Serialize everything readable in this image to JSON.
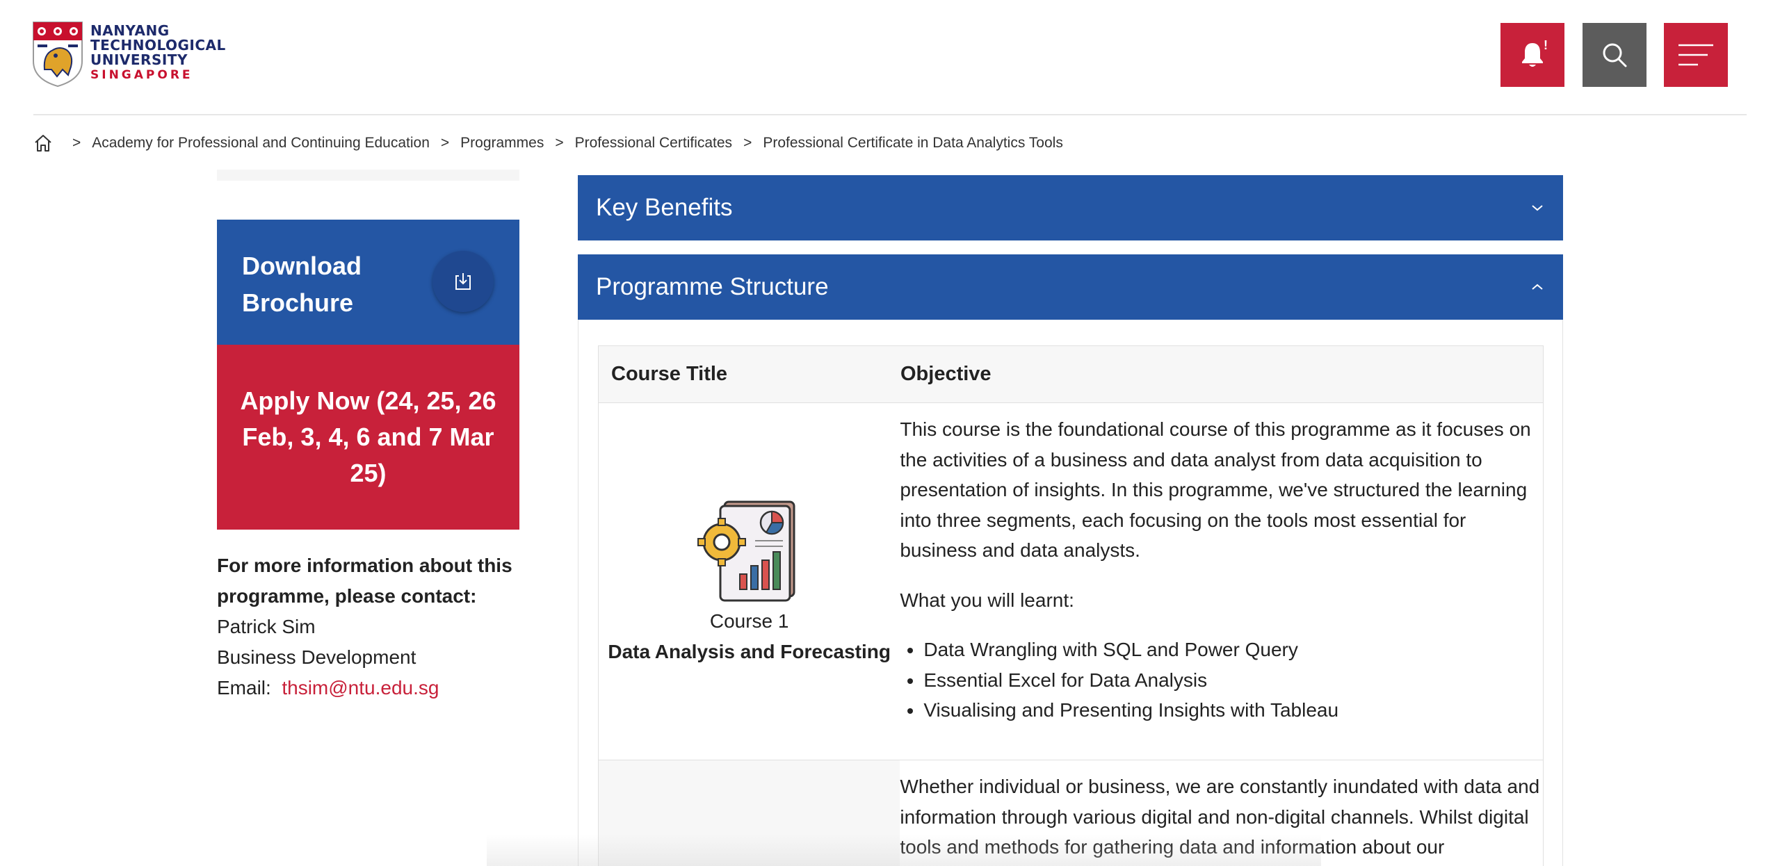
{
  "logo": {
    "line1": "NANYANG",
    "line2": "TECHNOLOGICAL",
    "line3": "UNIVERSITY",
    "line4": "SINGAPORE"
  },
  "header": {
    "notification_badge": "!",
    "icons": [
      "bell-icon",
      "search-icon",
      "menu-icon"
    ]
  },
  "breadcrumb": {
    "separator": ">",
    "items": [
      "Academy for Professional and Continuing Education",
      "Programmes",
      "Professional Certificates",
      "Professional Certificate in Data Analytics Tools"
    ]
  },
  "sidebar": {
    "download_label": "Download Brochure",
    "apply_label": "Apply Now (24, 25, 26 Feb, 3, 4, 6 and 7 Mar 25)",
    "contact_heading": "For more information about this programme, please contact:",
    "contact_name": "Patrick Sim",
    "contact_role": "Business Development",
    "email_label": "Email:",
    "email": "thsim@ntu.edu.sg"
  },
  "accordion": {
    "key_benefits": "Key Benefits",
    "programme_structure": "Programme Structure"
  },
  "table": {
    "headers": [
      "Course Title",
      "Objective"
    ],
    "rows": [
      {
        "course_number": "Course 1",
        "course_name": "Data Analysis and Forecasting",
        "objective": "This course is the foundational course of this programme as it focuses on the activities of a business and data analyst from data acquisition to presentation of insights.  In this programme, we've structured the learning into three segments, each focusing on the tools most essential for business and data analysts.",
        "learn_heading": "What you will learnt:",
        "learn_items": [
          "Data Wrangling with SQL and Power Query",
          "Essential Excel for Data Analysis",
          "Visualising and Presenting Insights with Tableau"
        ]
      },
      {
        "objective": "Whether individual or business, we are constantly inundated with data and information through various digital and non-digital channels.  Whilst digital tools and methods for gathering data and information about our"
      }
    ]
  },
  "colors": {
    "ntu_blue": "#2456a4",
    "ntu_red": "#c8213a",
    "search_grey": "#5c5c5c"
  }
}
